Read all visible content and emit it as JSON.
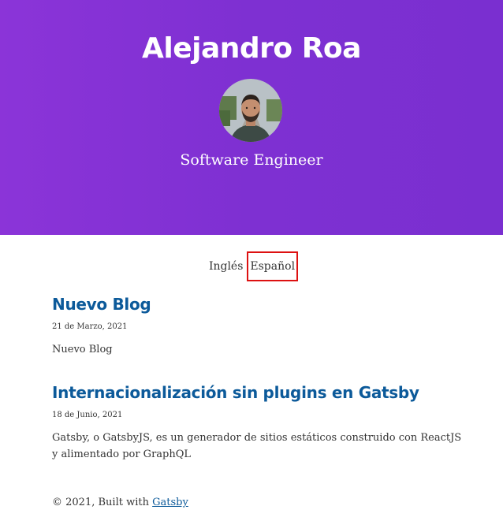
{
  "header": {
    "title": "Alejandro Roa",
    "tagline": "Software Engineer",
    "background_color": "#7f31d3"
  },
  "language_switcher": {
    "options": [
      {
        "label": "Inglés",
        "active": false
      },
      {
        "label": "Español",
        "active": true
      }
    ],
    "active_outline_color": "#dd1111"
  },
  "posts": [
    {
      "title": "Nuevo Blog",
      "date": "21 de Marzo, 2021",
      "excerpt": "Nuevo Blog"
    },
    {
      "title": "Internacionalización sin plugins en Gatsby",
      "date": "18 de Junio, 2021",
      "excerpt": "Gatsby, o GatsbyJS, es un generador de sitios estáticos construido con ReactJS y alimentado por GraphQL"
    }
  ],
  "footer": {
    "prefix": "© 2021, Built with",
    "link_label": "Gatsby"
  },
  "colors": {
    "link": "#0c5a9a",
    "text": "#333333"
  }
}
